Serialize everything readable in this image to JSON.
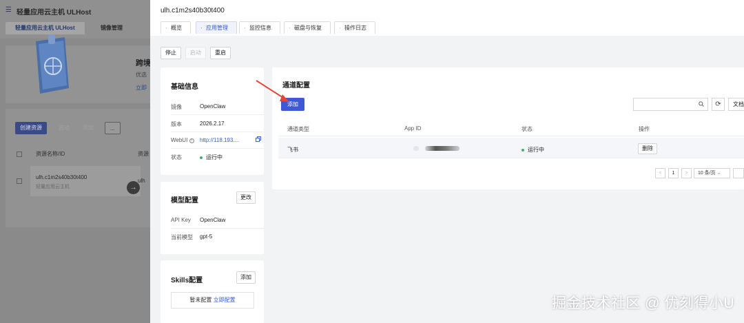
{
  "background": {
    "app_title": "轻量应用云主机 ULHost",
    "tabs": [
      "轻量应用云主机 ULHost",
      "镜像管理"
    ],
    "banner": {
      "title": "跨境",
      "subtitle": "优选",
      "link": "立即"
    },
    "toolbar": {
      "create": "创建资源",
      "btn2": "启动",
      "btn3": "添加",
      "more": "..."
    },
    "table": {
      "col_name": "资源名称/ID",
      "col_resource": "资源",
      "row": {
        "name": "ulh.c1m2s40b30t400",
        "sub": "轻量应用云主机",
        "col": "ulh"
      }
    }
  },
  "drawer": {
    "title": "ulh.c1m2s40b30t400",
    "tabs": [
      {
        "label": "概览",
        "active": false
      },
      {
        "label": "应用管理",
        "active": true
      },
      {
        "label": "监控信息",
        "active": false
      },
      {
        "label": "磁盘与恢复",
        "active": false
      },
      {
        "label": "操作日志",
        "active": false
      }
    ],
    "actions": {
      "stop": "停止",
      "start": "启动",
      "restart": "重启"
    },
    "basic_info": {
      "title": "基础信息",
      "rows": [
        {
          "label": "镜像",
          "value": "OpenClaw"
        },
        {
          "label": "版本",
          "value": "2026.2.17"
        },
        {
          "label": "WebUI",
          "value": "http://118.193...."
        },
        {
          "label": "状态",
          "value": "运行中"
        }
      ]
    },
    "model_config": {
      "title": "模型配置",
      "edit": "更改",
      "rows": [
        {
          "label": "API Key",
          "value": "OpenClaw"
        },
        {
          "label": "当前模型",
          "value": "gpt-5"
        }
      ]
    },
    "skills_config": {
      "title": "Skills配置",
      "add": "添加",
      "empty_text": "暂未配置",
      "empty_link": "立即配置"
    },
    "channel_config": {
      "title": "通道配置",
      "add": "添加",
      "search_placeholder": "",
      "docs": "文档",
      "columns": [
        "通道类型",
        "App ID",
        "状态",
        "操作"
      ],
      "rows": [
        {
          "type": "飞书",
          "app_id": "",
          "status": "运行中",
          "action": "删除"
        }
      ],
      "pagination": {
        "prev": "<",
        "page": "1",
        "next": ">",
        "page_size": "10 条/页"
      }
    }
  },
  "watermark": "掘金技术社区 @ 优刻得小U",
  "colors": {
    "primary": "#3f58d4",
    "link": "#3a5ccc",
    "status_ok": "#3fb36c",
    "annotation_arrow": "#e0483a"
  }
}
